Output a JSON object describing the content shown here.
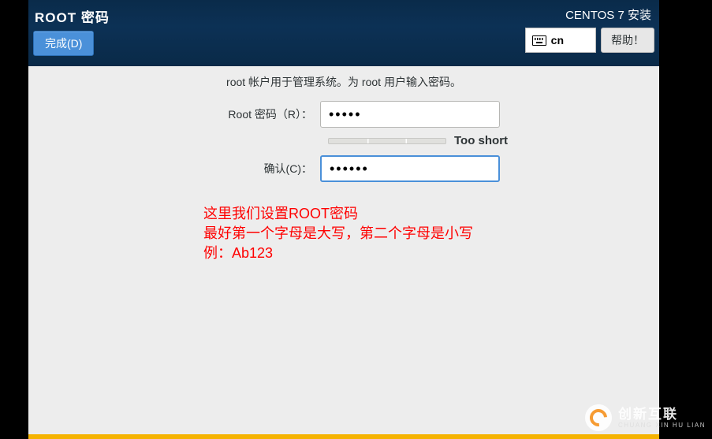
{
  "header": {
    "page_title": "ROOT 密码",
    "done_label": "完成(D)",
    "installer_title": "CENTOS 7 安装",
    "lang_code": "cn",
    "help_label": "帮助！"
  },
  "content": {
    "description": "root 帐户用于管理系统。为 root 用户输入密码。",
    "password_label": "Root 密码（R）：",
    "password_value": "•••••",
    "confirm_label": "确认(C)：",
    "confirm_value": "••••••",
    "strength_text": "Too short"
  },
  "annotations": {
    "line1": "这里我们设置ROOT密码",
    "line2": "最好第一个字母是大写，第二个字母是小写",
    "line3": "例：Ab123"
  },
  "watermark": {
    "cn": "创新互联",
    "en": "CHUANG XIN HU LIAN"
  }
}
